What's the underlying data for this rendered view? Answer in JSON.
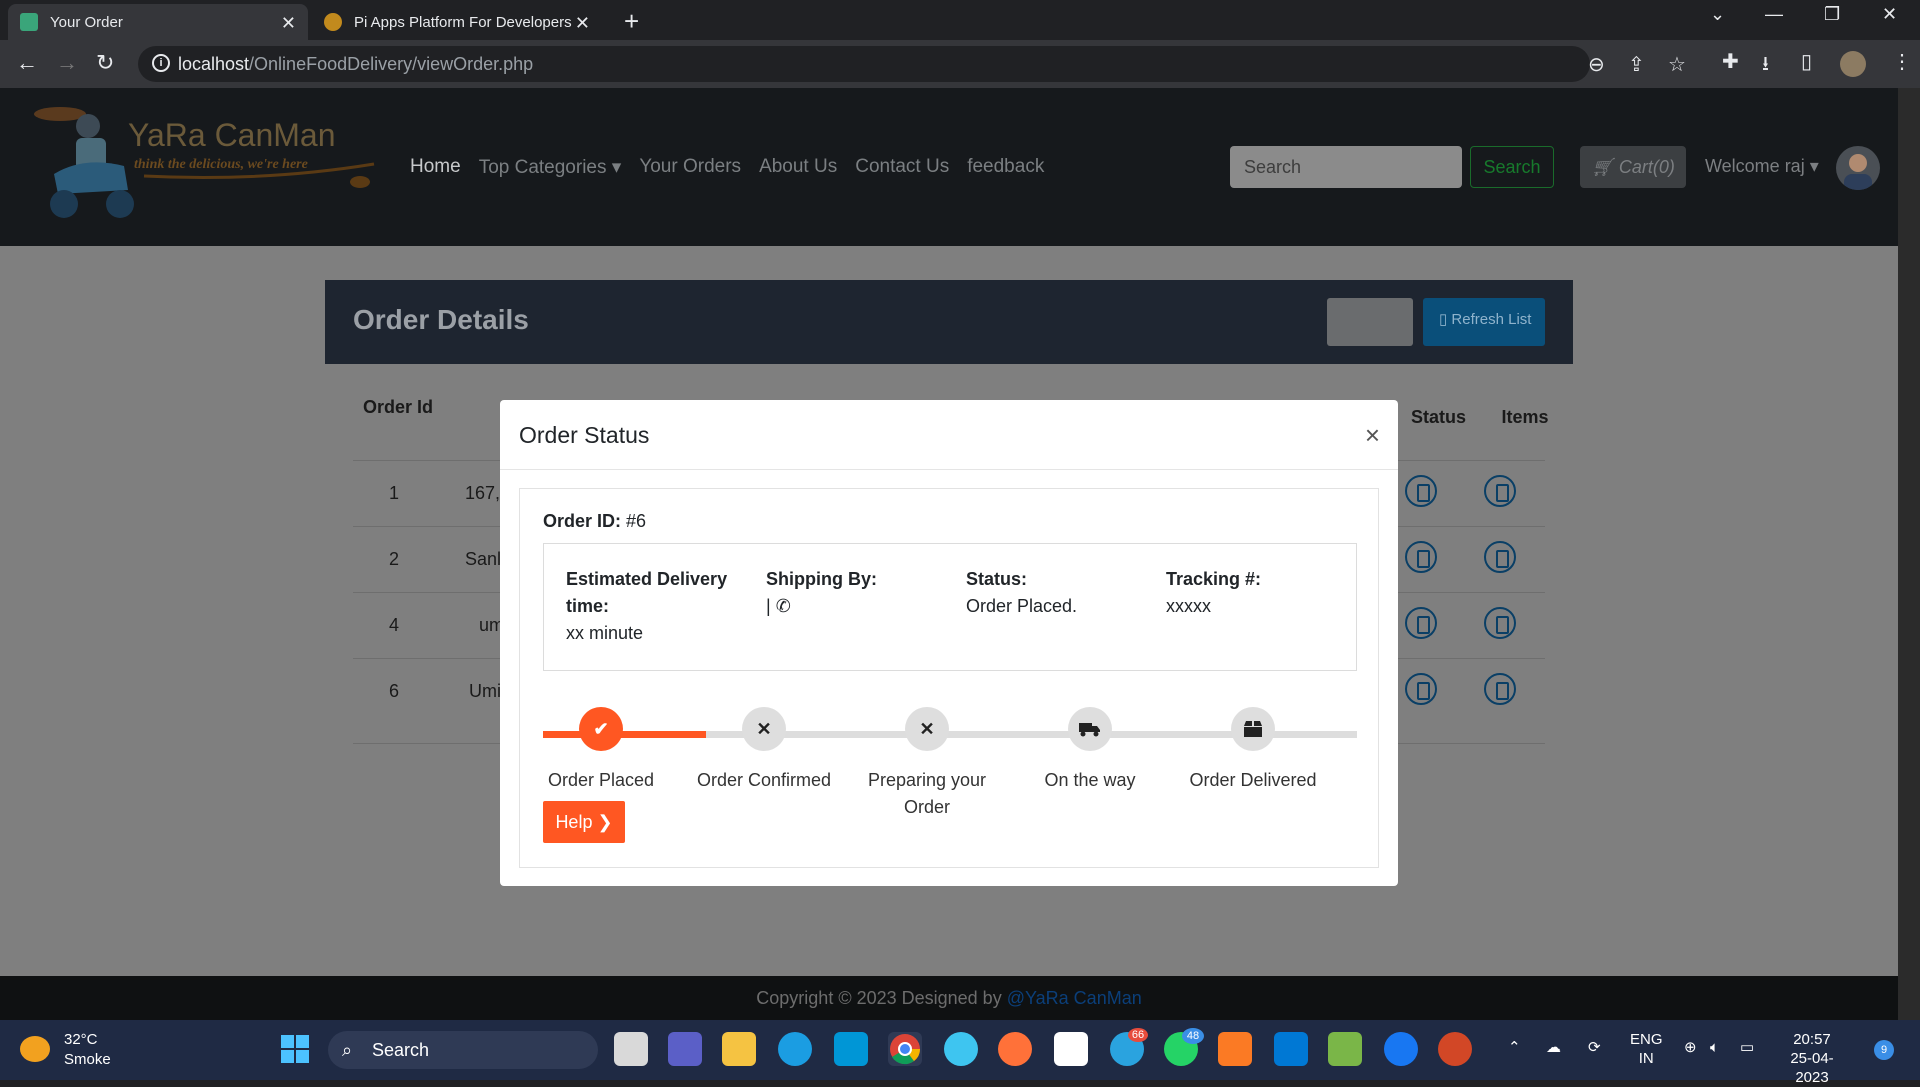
{
  "browser": {
    "tabs": [
      {
        "title": "Your Order",
        "active": true
      },
      {
        "title": "Pi Apps Platform For Developers",
        "active": false
      }
    ],
    "url_host": "localhost",
    "url_path": "/OnlineFoodDelivery/viewOrder.php"
  },
  "site": {
    "brand": "YaRa CanMan",
    "tagline": "think the delicious, we're here",
    "nav": [
      "Home",
      "Top Categories ▾",
      "Your Orders",
      "About Us",
      "Contact Us",
      "feedback"
    ],
    "search_placeholder": "Search",
    "search_button": "Search",
    "cart": "Cart(0)",
    "welcome": "Welcome raj ▾"
  },
  "orders_card": {
    "title": "Order Details",
    "refresh_button": "Refresh List",
    "columns": [
      "Order Id",
      "Status",
      "Items"
    ],
    "rows": [
      {
        "id": "1",
        "address": "167,"
      },
      {
        "id": "2",
        "address": "Sanl"
      },
      {
        "id": "4",
        "address": "um"
      },
      {
        "id": "6",
        "address": "Umi"
      }
    ]
  },
  "modal": {
    "title": "Order Status",
    "close": "×",
    "order_id_label": "Order ID:",
    "order_id_value": "#6",
    "delivery_label": "Estimated Delivery time:",
    "delivery_value": "xx minute",
    "shipping_label": "Shipping By:",
    "shipping_value": "|",
    "status_label": "Status:",
    "status_value": "Order Placed.",
    "tracking_label": "Tracking #:",
    "tracking_value": "xxxxx",
    "progress_fraction": 0.2,
    "steps": [
      {
        "label": "Order Placed",
        "icon": "check-icon",
        "done": true
      },
      {
        "label": "Order Confirmed",
        "icon": "x-icon",
        "done": false
      },
      {
        "label": "Preparing your Order",
        "icon": "x-icon",
        "done": false
      },
      {
        "label": "On the way",
        "icon": "truck-icon",
        "done": false
      },
      {
        "label": "Order Delivered",
        "icon": "box-icon",
        "done": false
      }
    ],
    "help_button": "Help ❯"
  },
  "footer": {
    "text": "Copyright © 2023 Designed by",
    "link": "@YaRa CanMan"
  },
  "taskbar": {
    "temp": "32°C",
    "weather": "Smoke",
    "search": "Search",
    "lang1": "ENG",
    "lang2": "IN",
    "time": "20:57",
    "date": "25-04-2023",
    "notifications": "9",
    "badge_telegram": "66",
    "badge_whatsapp": "48"
  },
  "colors": {
    "accent": "#ff5722",
    "navbar": "#16191c",
    "taskbar": "#1f2a44"
  }
}
